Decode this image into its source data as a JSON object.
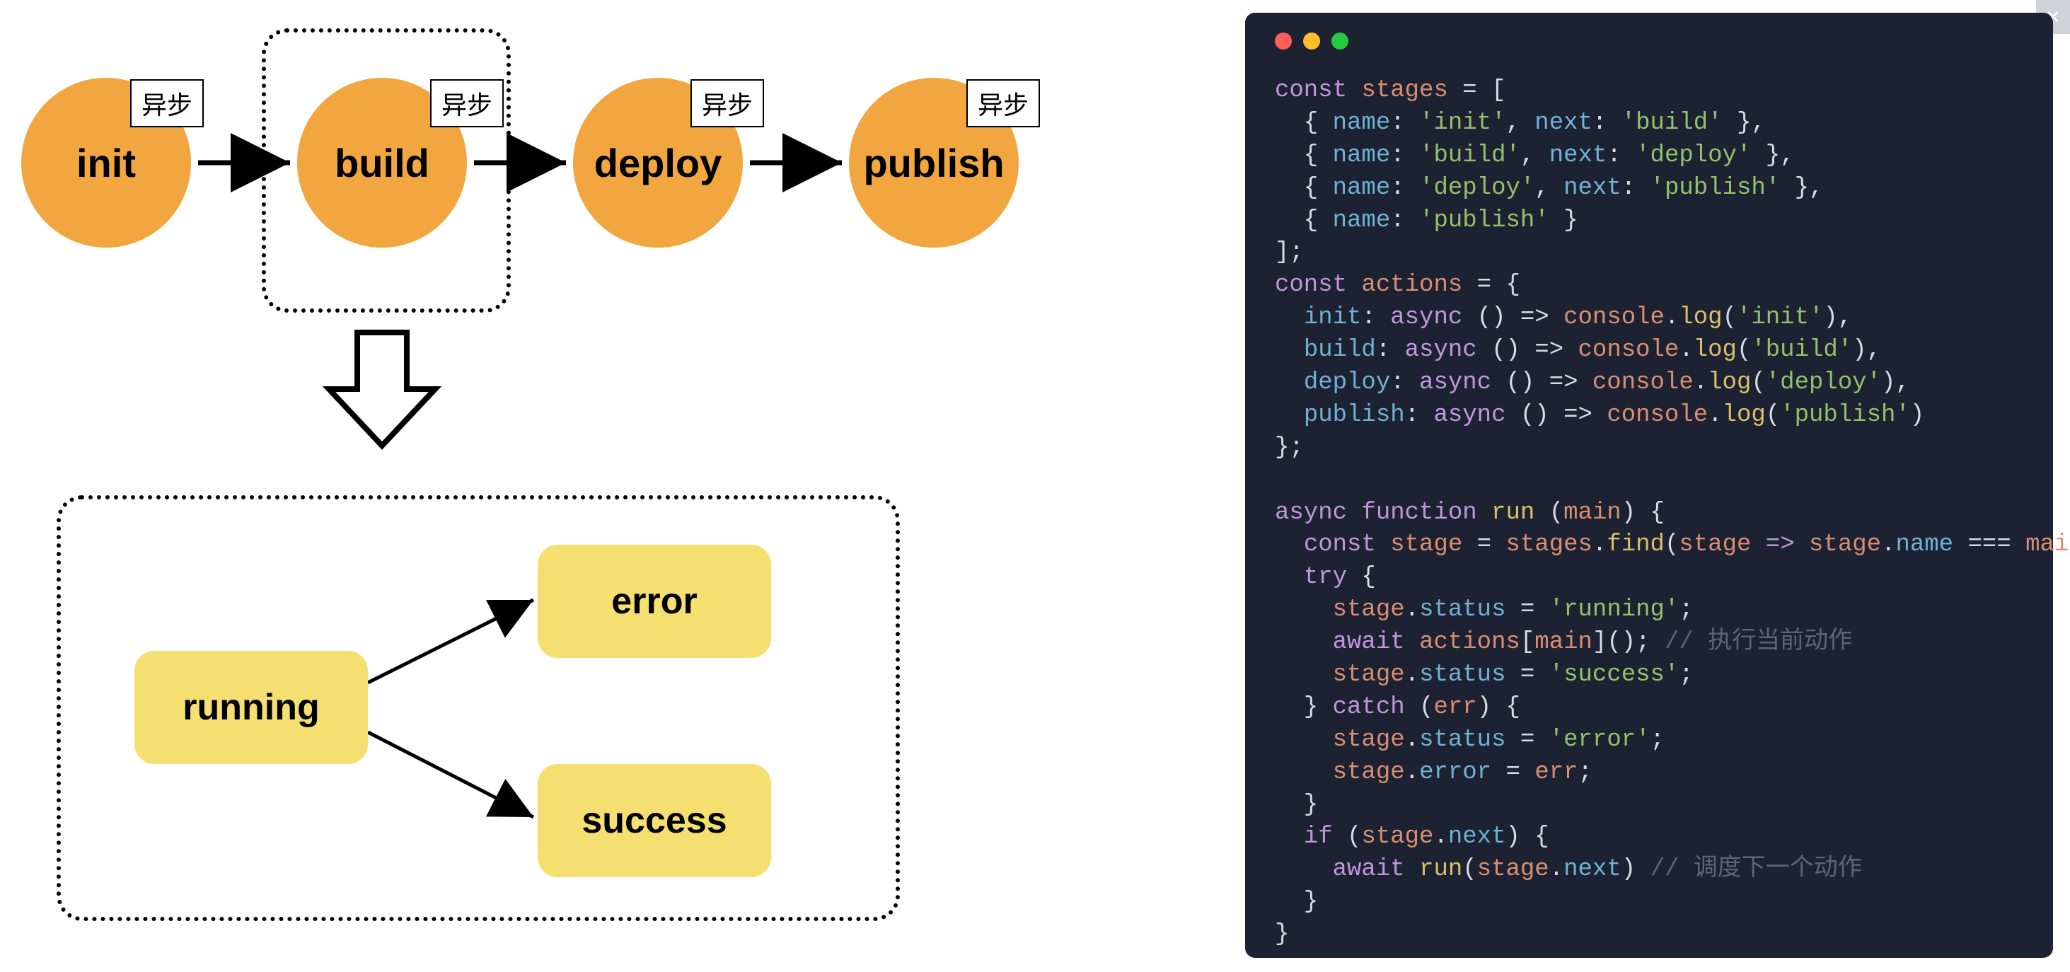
{
  "close_label": "×",
  "diagram": {
    "async_label": "异步",
    "stages": [
      "init",
      "build",
      "deploy",
      "publish"
    ],
    "states": {
      "running": "running",
      "error": "error",
      "success": "success"
    }
  },
  "code": {
    "l1": {
      "kw1": "const",
      "id": "stages",
      "op": " = ["
    },
    "l2": {
      "ind": "  { ",
      "p1": "name",
      "c": ": ",
      "s1": "'init'",
      "cm": ", ",
      "p2": "next",
      "c2": ": ",
      "s2": "'build'",
      "end": " },"
    },
    "l3": {
      "ind": "  { ",
      "p1": "name",
      "c": ": ",
      "s1": "'build'",
      "cm": ", ",
      "p2": "next",
      "c2": ": ",
      "s2": "'deploy'",
      "end": " },"
    },
    "l4": {
      "ind": "  { ",
      "p1": "name",
      "c": ": ",
      "s1": "'deploy'",
      "cm": ", ",
      "p2": "next",
      "c2": ": ",
      "s2": "'publish'",
      "end": " },"
    },
    "l5": {
      "ind": "  { ",
      "p1": "name",
      "c": ": ",
      "s1": "'publish'",
      "end": " }"
    },
    "l6": {
      "t": "];"
    },
    "l7": {
      "kw1": "const",
      "id": "actions",
      "op": " = {"
    },
    "l8": {
      "ind": "  ",
      "p": "init",
      "mid": ": ",
      "kw": "async",
      "arr": " () => ",
      "obj": "console",
      "dot": ".",
      "fn": "log",
      "open": "(",
      "s": "'init'",
      "close": "),"
    },
    "l9": {
      "ind": "  ",
      "p": "build",
      "mid": ": ",
      "kw": "async",
      "arr": " () => ",
      "obj": "console",
      "dot": ".",
      "fn": "log",
      "open": "(",
      "s": "'build'",
      "close": "),"
    },
    "l10": {
      "ind": "  ",
      "p": "deploy",
      "mid": ": ",
      "kw": "async",
      "arr": " () => ",
      "obj": "console",
      "dot": ".",
      "fn": "log",
      "open": "(",
      "s": "'deploy'",
      "close": "),"
    },
    "l11": {
      "ind": "  ",
      "p": "publish",
      "mid": ": ",
      "kw": "async",
      "arr": " () => ",
      "obj": "console",
      "dot": ".",
      "fn": "log",
      "open": "(",
      "s": "'publish'",
      "close": ")"
    },
    "l12": {
      "t": "};"
    },
    "l13": {
      "t": ""
    },
    "l14": {
      "kw1": "async function",
      "fn": " run ",
      "open": "(",
      "arg": "main",
      "close": ") {"
    },
    "l15": {
      "ind": "  ",
      "kw": "const",
      "sp": " ",
      "id": "stage",
      "op": " = ",
      "obj": "stages",
      "dot": ".",
      "fn": "find",
      "call": "(",
      "arg": "stage",
      "arr": " => ",
      "o2": "stage",
      "d2": ".",
      "p2": "name",
      "eq": " === ",
      "m": "main",
      "end": ");"
    },
    "l16": {
      "ind": "  ",
      "kw": "try",
      "t": " {"
    },
    "l17": {
      "ind": "    ",
      "o": "stage",
      "d": ".",
      "p": "status",
      "eq": " = ",
      "s": "'running'",
      "end": ";"
    },
    "l18": {
      "ind": "    ",
      "kw": "await",
      "sp": " ",
      "o": "actions",
      "br": "[",
      "a": "main",
      "brc": "](); ",
      "cm": "// 执行当前动作"
    },
    "l19": {
      "ind": "    ",
      "o": "stage",
      "d": ".",
      "p": "status",
      "eq": " = ",
      "s": "'success'",
      "end": ";"
    },
    "l20": {
      "ind": "  } ",
      "kw": "catch",
      "open": " (",
      "arg": "err",
      "close": ") {"
    },
    "l21": {
      "ind": "    ",
      "o": "stage",
      "d": ".",
      "p": "status",
      "eq": " = ",
      "s": "'error'",
      "end": ";"
    },
    "l22": {
      "ind": "    ",
      "o": "stage",
      "d": ".",
      "p": "error",
      "eq": " = ",
      "v": "err",
      "end": ";"
    },
    "l23": {
      "t": "  }"
    },
    "l24": {
      "ind": "  ",
      "kw": "if",
      "open": " (",
      "o": "stage",
      "d": ".",
      "p": "next",
      "close": ") {"
    },
    "l25": {
      "ind": "    ",
      "kw": "await",
      "sp": " ",
      "fn": "run",
      "open": "(",
      "o": "stage",
      "d": ".",
      "p": "next",
      "close": ") ",
      "cm": "// 调度下一个动作"
    },
    "l26": {
      "t": "  }"
    },
    "l27": {
      "t": "}"
    }
  }
}
